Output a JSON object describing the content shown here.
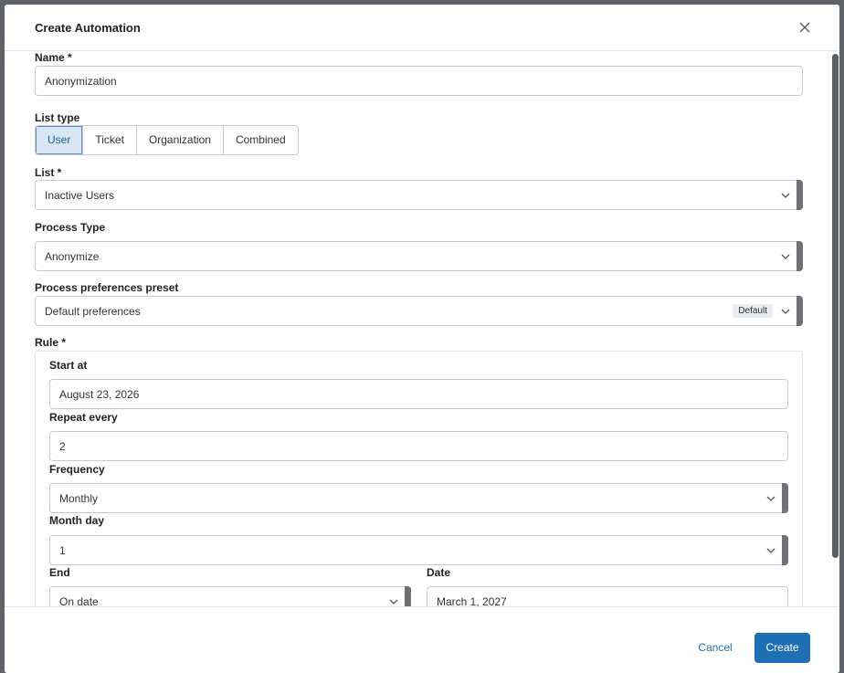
{
  "dialog": {
    "title": "Create Automation"
  },
  "name": {
    "label": "Name *",
    "value": "Anonymization"
  },
  "list_type": {
    "label": "List type",
    "options": [
      "User",
      "Ticket",
      "Organization",
      "Combined"
    ],
    "selected": "User"
  },
  "list": {
    "label": "List *",
    "value": "Inactive Users"
  },
  "process_type": {
    "label": "Process Type",
    "value": "Anonymize"
  },
  "preset": {
    "label": "Process preferences preset",
    "value": "Default preferences",
    "badge": "Default"
  },
  "rule": {
    "label": "Rule *",
    "start_at": {
      "label": "Start at",
      "value": "August 23, 2026"
    },
    "repeat_every": {
      "label": "Repeat every",
      "value": "2"
    },
    "frequency": {
      "label": "Frequency",
      "value": "Monthly"
    },
    "month_day": {
      "label": "Month day",
      "value": "1"
    },
    "end": {
      "label": "End",
      "value": "On date"
    },
    "date": {
      "label": "Date",
      "value": "March 1, 2027"
    }
  },
  "footer": {
    "cancel_label": "Cancel",
    "create_label": "Create"
  },
  "colors": {
    "primary": "#1f6fb5",
    "selected_bg": "#d8e6f3",
    "border": "#c8cbcf"
  }
}
